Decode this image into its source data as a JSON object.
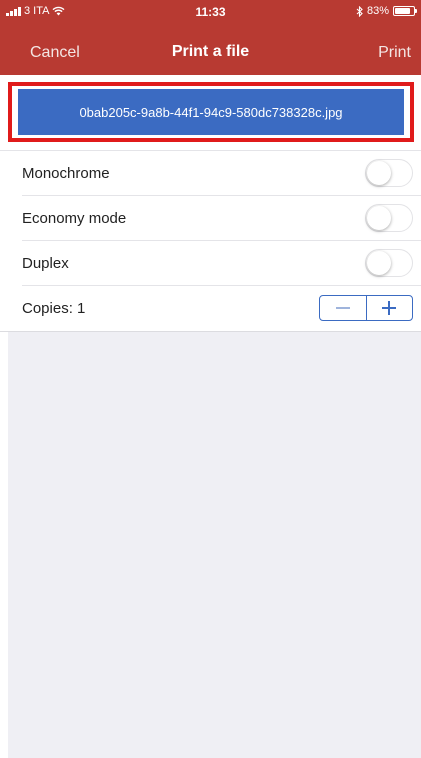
{
  "status_bar": {
    "carrier": "3 ITA",
    "time": "11:33",
    "battery_percent": "83%",
    "battery_level": 0.83
  },
  "nav": {
    "cancel_label": "Cancel",
    "title": "Print a file",
    "print_label": "Print"
  },
  "file": {
    "name": "0bab205c-9a8b-44f1-94c9-580dc738328c.jpg"
  },
  "settings": {
    "monochrome": {
      "label": "Monochrome",
      "on": false
    },
    "economy_mode": {
      "label": "Economy mode",
      "on": false
    },
    "duplex": {
      "label": "Duplex",
      "on": false
    },
    "copies": {
      "label": "Copies: 1"
    }
  },
  "colors": {
    "header": "#b83a32",
    "accent": "#3b6bc2",
    "highlight": "#e01b1b",
    "background": "#efeff4"
  }
}
